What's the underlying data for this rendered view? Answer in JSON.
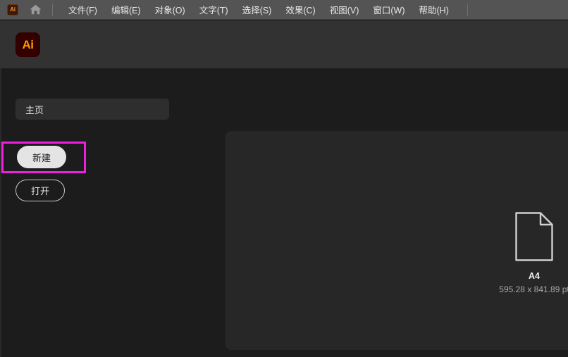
{
  "app": {
    "brand_short": "Ai",
    "brand_chip_bg": "#3a1a0c",
    "brand_accent": "#ff9a00",
    "logo_bg": "#330000"
  },
  "menubar": {
    "home_icon": "home-icon",
    "items": [
      {
        "label": "文件(F)"
      },
      {
        "label": "编辑(E)"
      },
      {
        "label": "对象(O)"
      },
      {
        "label": "文字(T)"
      },
      {
        "label": "选择(S)"
      },
      {
        "label": "效果(C)"
      },
      {
        "label": "视图(V)"
      },
      {
        "label": "窗口(W)"
      },
      {
        "label": "帮助(H)"
      }
    ]
  },
  "sidebar": {
    "home_tab": {
      "label": "主页"
    },
    "buttons": [
      {
        "label": "新建",
        "style": "primary",
        "highlighted": true
      },
      {
        "label": "打开",
        "style": "outline",
        "highlighted": false
      }
    ],
    "highlight_color": "#ef1fe0"
  },
  "content": {
    "presets": [
      {
        "icon": "document-page-icon",
        "name": "A4",
        "dimensions": "595.28 x 841.89 pt"
      }
    ]
  }
}
